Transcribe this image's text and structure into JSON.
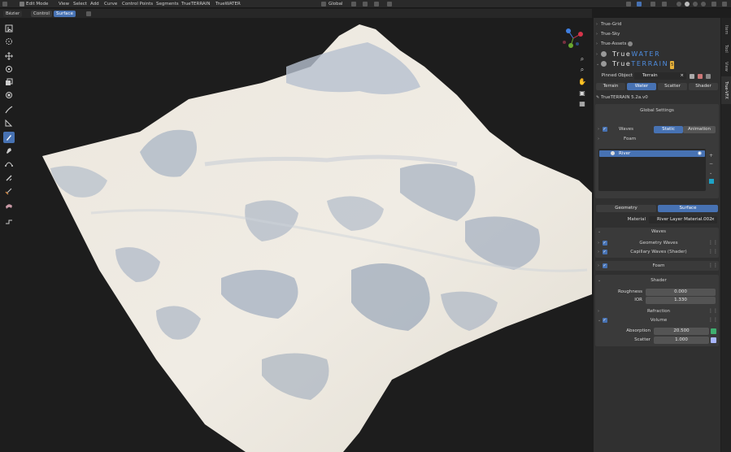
{
  "header": {
    "mode": "Edit Mode",
    "menus": [
      "View",
      "Select",
      "Add",
      "Curve",
      "Control Points",
      "Segments",
      "TrueTERRAIN",
      "TrueWATER"
    ],
    "transform_orientation": "Global"
  },
  "subheader": {
    "brush": "Bézier",
    "tabs": [
      "Control",
      "Surface"
    ]
  },
  "tabs_vertical": [
    "Item",
    "Tool",
    "View",
    "True-VFX"
  ],
  "panel": {
    "addons": [
      {
        "label": "True-Grid"
      },
      {
        "label": "True-Sky"
      },
      {
        "label": "True-Assets"
      }
    ],
    "brand_water": {
      "prefix": "True",
      "accent": "WATER"
    },
    "brand_terrain": {
      "prefix": "True",
      "accent": "TERRAIN",
      "badge": "5"
    },
    "pinned_object_label": "Pinned Object",
    "pinned_object_value": "Terrain",
    "mode_tabs": [
      "Terrain",
      "Water",
      "Scatter",
      "Shader"
    ],
    "active_mode_tab": "Water",
    "version": "TrueTERRAIN 5.2a.v0",
    "global_settings": "Global Settings",
    "waves_label": "Waves",
    "waves_static": "Static",
    "waves_animation": "Animation",
    "foam_label": "Foam",
    "list_item": "River",
    "geo_tab": "Geometry",
    "surface_tab": "Surface",
    "material_label": "Material",
    "material_value": "River Layer Material.002",
    "waves_section": "Waves",
    "geometry_waves": "Geometry Waves",
    "capillary_waves": "Capillary Waves (Shader)",
    "foam_section": "Foam",
    "shader_section": "Shader",
    "roughness_label": "Roughness",
    "roughness_value": "0.000",
    "ior_label": "IOR",
    "ior_value": "1.330",
    "refraction_label": "Refraction",
    "volume_label": "Volume",
    "absorption_label": "Absorption",
    "absorption_value": "20.500",
    "scatter_label": "Scatter",
    "scatter_value": "1.000"
  },
  "colors": {
    "accent": "#4772b3",
    "brand_blue": "#4e8de0",
    "absorption_swatch": "#3fae6f",
    "scatter_swatch": "#a9b6ff",
    "terrain_light": "#e9e3d8",
    "terrain_shadow": "#a8b3c2"
  },
  "icons": [
    "select-box-icon",
    "cursor-icon",
    "move-icon",
    "rotate-icon",
    "scale-icon",
    "transform-icon",
    "annotate-icon",
    "measure-icon",
    "draw-icon",
    "pen-icon",
    "curve-pen-icon",
    "tilt-icon",
    "radius-icon",
    "randomize-icon",
    "extrude-icon"
  ]
}
